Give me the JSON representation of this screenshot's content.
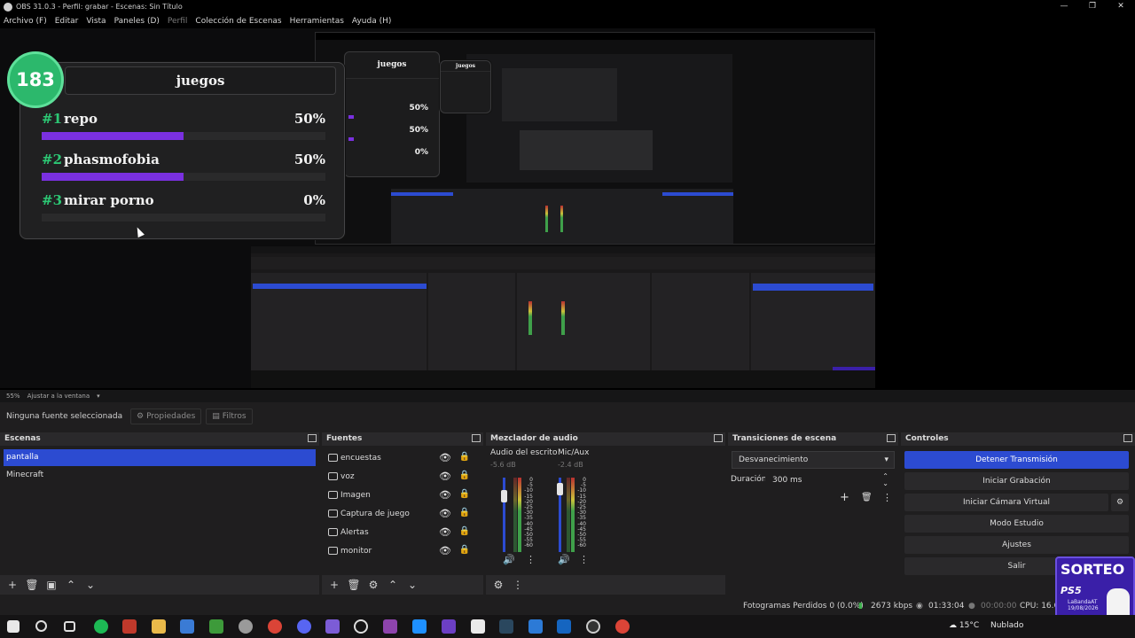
{
  "window": {
    "title": "OBS 31.0.3 - Perfil: grabar - Escenas: Sin Título",
    "controls": [
      "—",
      "❐",
      "✕"
    ]
  },
  "menu": [
    "Archivo (F)",
    "Editar",
    "Vista",
    "Paneles (D)",
    "Perfil",
    "Colección de Escenas",
    "Herramientas",
    "Ayuda (H)"
  ],
  "poll": {
    "count": "183",
    "title": "juegos",
    "items": [
      {
        "rank": "#1",
        "name": "repo",
        "pct": "50%",
        "value": 0.5
      },
      {
        "rank": "#2",
        "name": "phasmofobia",
        "pct": "50%",
        "value": 0.5
      },
      {
        "rank": "#3",
        "name": "mirar porno",
        "pct": "0%",
        "value": 0
      }
    ]
  },
  "zoom": {
    "level": "55%",
    "fit": "Ajustar a la ventana"
  },
  "context": {
    "none": "Ninguna fuente seleccionada",
    "properties": "Propiedades",
    "filters": "Filtros"
  },
  "scenes": {
    "title": "Escenas",
    "items": [
      "pantalla",
      "Minecraft"
    ],
    "active": 0
  },
  "sources": {
    "title": "Fuentes",
    "items": [
      "encuestas",
      "voz",
      "Imagen",
      "Captura de juego",
      "Alertas",
      "monitor"
    ]
  },
  "mixer": {
    "title": "Mezclador de audio",
    "channels": [
      {
        "name": "Audio del escrito",
        "db": "-5.6 dB"
      },
      {
        "name": "Mic/Aux",
        "db": "-2.4 dB"
      }
    ],
    "scale": [
      "0",
      "-5",
      "-10",
      "-15",
      "-20",
      "-25",
      "-30",
      "-35",
      "-40",
      "-45",
      "-50",
      "-55",
      "-60"
    ]
  },
  "transitions": {
    "title": "Transiciones de escena",
    "selected": "Desvanecimiento",
    "duration_label": "Duración",
    "duration": "300 ms"
  },
  "controls": {
    "title": "Controles",
    "buttons": [
      "Detener Transmisión",
      "Iniciar Grabación",
      "Iniciar Cámara Virtual",
      "Modo Estudio",
      "Ajustes",
      "Salir"
    ]
  },
  "status": {
    "dropped": "Fotogramas Perdidos 0 (0.0%)",
    "bitrate": "2673 kbps",
    "live_time": "01:33:04",
    "rec_time": "00:00:00",
    "cpu": "CPU: 16.6%"
  },
  "sorteo": {
    "label": "SORTEO",
    "console": "PS5",
    "handle": "LaBandaAT",
    "date": "19/08/2026"
  },
  "taskbar": {
    "weather": "15°C",
    "condition": "Nublado"
  },
  "colors": {
    "accent": "#2c4bd1",
    "poll_green": "#2cc774",
    "poll_bar": "#7a30e0"
  }
}
